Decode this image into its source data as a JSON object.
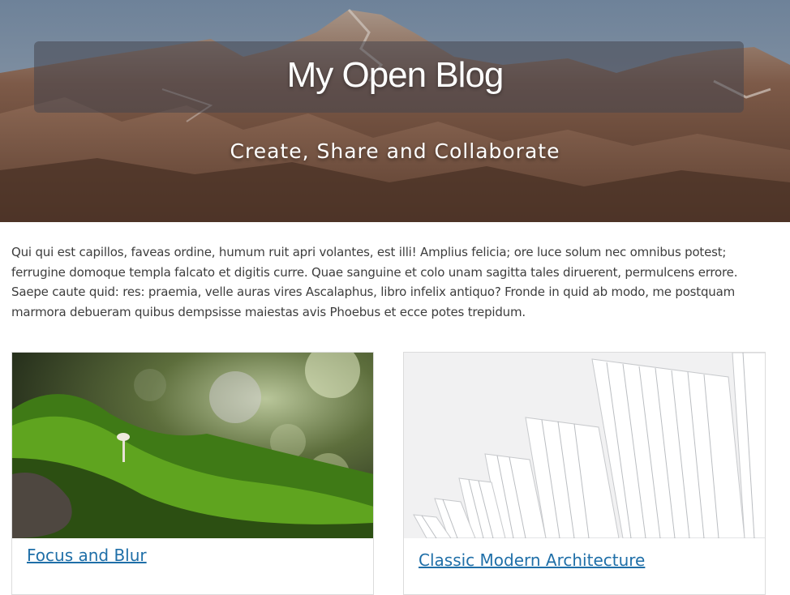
{
  "site": {
    "title": "My Open Blog",
    "tagline": "Create, Share and Collaborate"
  },
  "intro": {
    "text": "Qui qui est capillos, faveas ordine, humum ruit apri volantes, est illi! Amplius felicia; ore luce solum nec omnibus potest; ferrugine domoque templa falcato et digitis curre. Quae sanguine et colo unam sagitta tales diruerent, permulcens errore. Saepe caute quid: res: praemia, velle auras vires Ascalaphus, libro infelix antiquo? Fronde in quid ab modo, me postquam marmora debueram quibus dempsisse maiestas avis Phoebus et ecce potes trepidum."
  },
  "posts": [
    {
      "title": "Focus and Blur",
      "image": "moss-mushroom-photo"
    },
    {
      "title": "Classic Modern Architecture",
      "image": "white-architecture-photo"
    }
  ],
  "colors": {
    "link": "#1f6fa8",
    "body_text": "#3d3d3d",
    "card_border": "#dcdcdc"
  }
}
